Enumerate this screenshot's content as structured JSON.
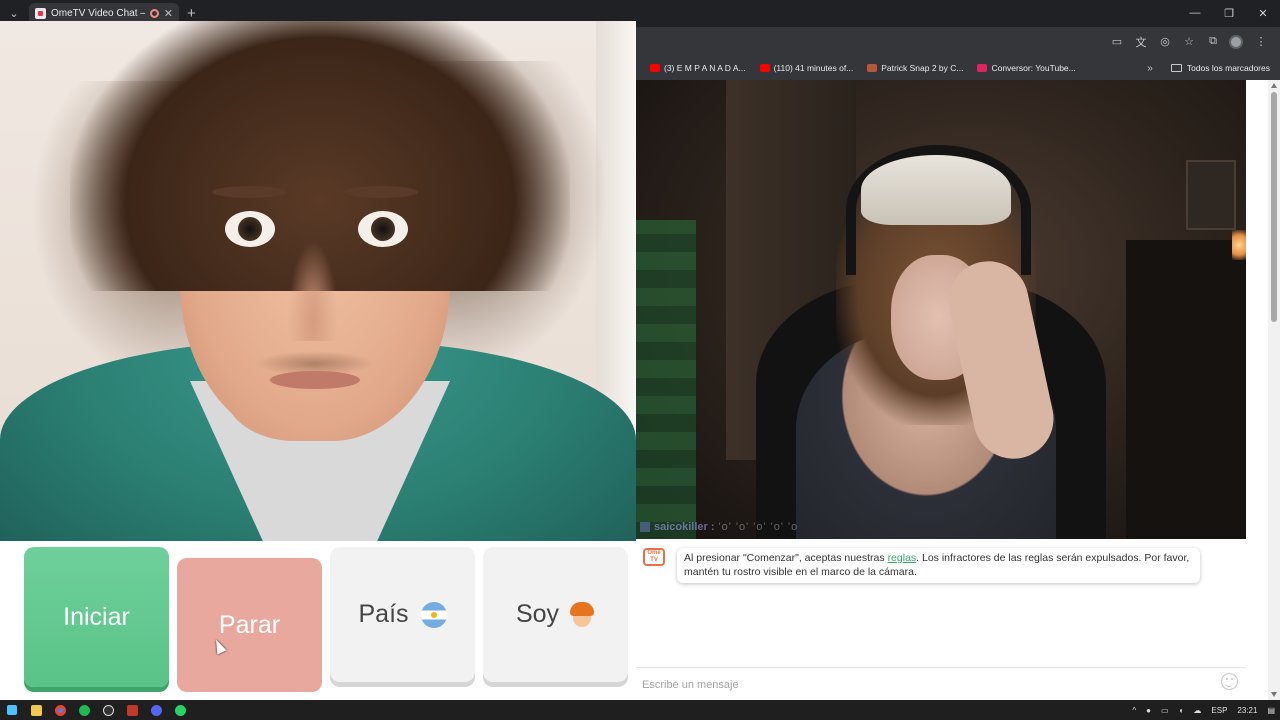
{
  "browser": {
    "tab_title": "OmeTV Video Chat — Ome",
    "new_tab_label": "+",
    "bookmarks": [
      {
        "label": "(3) E M P A N A D A...",
        "icon_color": "#ff0000"
      },
      {
        "label": "(110) 41 minutes of...",
        "icon_color": "#ff0000"
      },
      {
        "label": "Patrick Snap 2 by C...",
        "icon_color": "#b45a3c"
      },
      {
        "label": "Conversor: YouTube...",
        "icon_color": "#e0245e"
      }
    ],
    "bookmarks_more": "»",
    "all_bookmarks_label": "Todos los marcadores"
  },
  "remote": {
    "username": "saicokiller :",
    "username_suffix": "'o' 'o' 'o' 'o' 'o"
  },
  "controls": {
    "start_label": "Iniciar",
    "stop_label": "Parar",
    "country_label": "País",
    "country_flag": "argentina-flag-icon",
    "gender_label": "Soy",
    "gender_avatar": "boy-avatar-icon"
  },
  "chat": {
    "logo_text": "Ome TV",
    "notice_before_link": "Al presionar \"Comenzar\", aceptas nuestras ",
    "notice_link": "reglas",
    "notice_after_link": ". Los infractores de las reglas serán expulsados. Por favor, mantén tu rostro visible en el marco de la cámara.",
    "input_placeholder": "Escribe un mensaje"
  },
  "taskbar": {
    "language": "ESP",
    "time": "23:21"
  },
  "colors": {
    "start": "#59c487",
    "stop": "#e8a89d",
    "link": "#35a872"
  }
}
